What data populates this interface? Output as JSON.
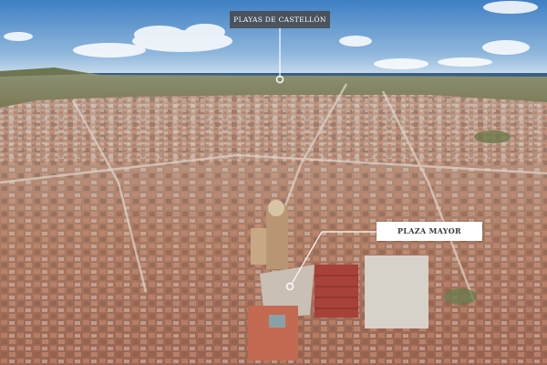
{
  "labels": {
    "beach": "PLAYAS DE CASTELLÓN",
    "plaza": "PLAZA MAYOR"
  },
  "colors": {
    "sky_top": "#3f7fc4",
    "sky_horizon": "#cfe0ee",
    "sea": "#3a5f86",
    "countryside": "#7d8a5e",
    "roofs": "#b5806a",
    "callout_dark": "#464646",
    "callout_light": "#ffffff"
  }
}
